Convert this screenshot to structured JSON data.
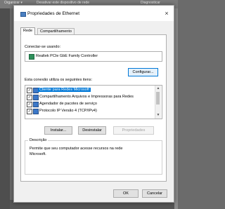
{
  "background": {
    "toolbar": [
      "Organizar ▾",
      "Desativar este dispositivo de rede",
      "Diagnosticar"
    ]
  },
  "dialog": {
    "title": "Propriedades de Ethernet",
    "close_glyph": "×",
    "tabs": [
      {
        "label": "Rede",
        "active": true
      },
      {
        "label": "Compartilhamento",
        "active": false
      }
    ],
    "connect_using_label": "Conectar-se usando:",
    "adapter_name": "Realtek PCIe GbE Family Controller",
    "configure_button": "Configurar...",
    "items_label": "Esta conexão utiliza os seguintes itens:",
    "items": [
      {
        "label": "Cliente para Redes Microsoft",
        "checked": true,
        "selected": true,
        "check": "✓"
      },
      {
        "label": "Compartilhamento Arquivos e Impressoras para Redes",
        "checked": true,
        "selected": false,
        "check": "✓"
      },
      {
        "label": "Agendador de pacotes de serviço",
        "checked": true,
        "selected": false,
        "check": "✓"
      },
      {
        "label": "Protocolo IP Versão 4 (TCP/IPv4)",
        "checked": true,
        "selected": false,
        "check": "✓"
      }
    ],
    "scroll_up": "▲",
    "scroll_down": "▼",
    "install_button": "Instalar...",
    "uninstall_button": "Desinstalar",
    "properties_button": "Propriedades",
    "description_title": "Descrição",
    "description_text": "Permite que seu computador acesse recursos na rede Microsoft.",
    "ok_button": "OK",
    "cancel_button": "Cancelar",
    "accent": "#0078d7"
  }
}
